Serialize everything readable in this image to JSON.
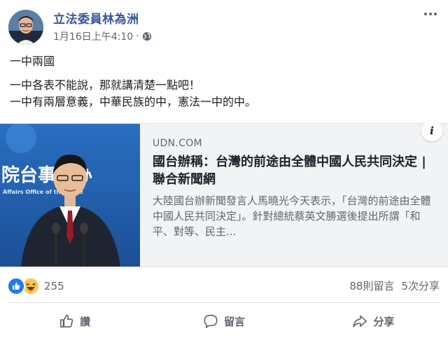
{
  "post": {
    "page_name": "立法委員林為洲",
    "timestamp": "1月16日上午4:10",
    "dot": "·",
    "text_lines": [
      "一中兩國",
      "一中各表不能說，那就講清楚一點吧！",
      "一中有兩層意義，中華民族的中，憲法一中的中。"
    ]
  },
  "link_preview": {
    "domain": "UDN.COM",
    "headline": "國台辦稱：台灣的前途由全體中國人民共同決定 | 聯合新聞網",
    "description": "大陸國台辦新聞發言人馬曉光今天表示，「台灣的前途由全體中國人民共同決定」。針對總統蔡英文勝選後提出所謂「和平、對等、民主...",
    "thumbnail_backdrop_text": "院台事务办",
    "thumbnail_subtext": "Affairs Office of the State",
    "info_label": "i"
  },
  "reactions": {
    "count": "255",
    "comments": "88則留言",
    "shares": "5次分享",
    "icons": [
      "like-reaction-icon",
      "haha-reaction-icon"
    ]
  },
  "actions": {
    "like": "讚",
    "comment": "留言",
    "share": "分享"
  },
  "colors": {
    "link_blue": "#385898",
    "like_blue": "#2078f4",
    "haha_yellow": "#f7c94a",
    "secondary_text": "#606770",
    "card_bg": "#f2f3f5"
  }
}
